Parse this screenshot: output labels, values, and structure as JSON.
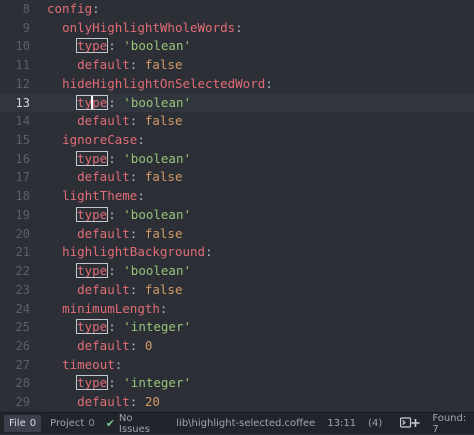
{
  "editor": {
    "lines": [
      {
        "n": "8"
      },
      {
        "n": "9"
      },
      {
        "n": "10"
      },
      {
        "n": "11"
      },
      {
        "n": "12"
      },
      {
        "n": "13"
      },
      {
        "n": "14"
      },
      {
        "n": "15"
      },
      {
        "n": "16"
      },
      {
        "n": "17"
      },
      {
        "n": "18"
      },
      {
        "n": "19"
      },
      {
        "n": "20"
      },
      {
        "n": "21"
      },
      {
        "n": "22"
      },
      {
        "n": "23"
      },
      {
        "n": "24"
      },
      {
        "n": "25"
      },
      {
        "n": "26"
      },
      {
        "n": "27"
      },
      {
        "n": "28"
      },
      {
        "n": "29"
      }
    ],
    "tokens": {
      "config": "config",
      "colon": ":",
      "type": "type",
      "default": "default",
      "boolean": "'boolean'",
      "integer": "'integer'",
      "false": "false",
      "zero": "0",
      "twenty": "20",
      "onlyHighlightWholeWords": "onlyHighlightWholeWords",
      "hideHighlightOnSelectedWord": "hideHighlightOnSelectedWord",
      "ignoreCase": "ignoreCase",
      "lightTheme": "lightTheme",
      "highlightBackground": "highlightBackground",
      "minimumLength": "minimumLength",
      "timeout": "timeout"
    }
  },
  "status_bar": {
    "file_tab": {
      "label": "File",
      "count": "0"
    },
    "project_tab": {
      "label": "Project",
      "count": "0"
    },
    "issues": "No Issues",
    "file_path": "lib\\highlight-selected.coffee",
    "cursor_position": "13:11",
    "selection_count": "(4)",
    "found": "Found: 7"
  },
  "colors": {
    "background": "#2c2f36",
    "key": "#e06c75",
    "string": "#98c379",
    "literal": "#d19a66",
    "status_bg": "#21252b",
    "issues_check": "#73c990"
  },
  "icons": {
    "issues": "check-icon",
    "git": "terminal-plus-icon"
  }
}
